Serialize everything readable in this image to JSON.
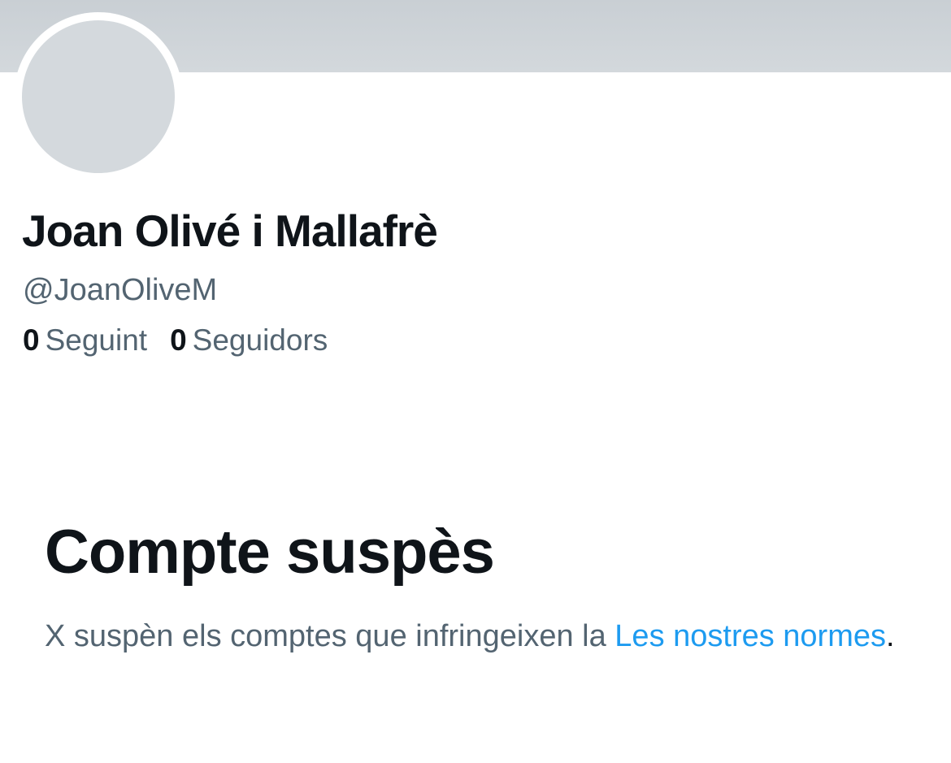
{
  "profile": {
    "display_name": "Joan Olivé i Mallafrè",
    "handle": "@JoanOliveM",
    "following_count": "0",
    "following_label": "Seguint",
    "followers_count": "0",
    "followers_label": "Seguidors"
  },
  "suspension": {
    "title": "Compte suspès",
    "message": "X suspèn els comptes que infringeixen la ",
    "link_text": "Les nostres normes",
    "trailing": "."
  },
  "colors": {
    "banner": "#CFD5D9",
    "avatar_placeholder": "#D4D9DD",
    "primary_text": "#0F1419",
    "secondary_text": "#536471",
    "link": "#1D9BF0"
  }
}
